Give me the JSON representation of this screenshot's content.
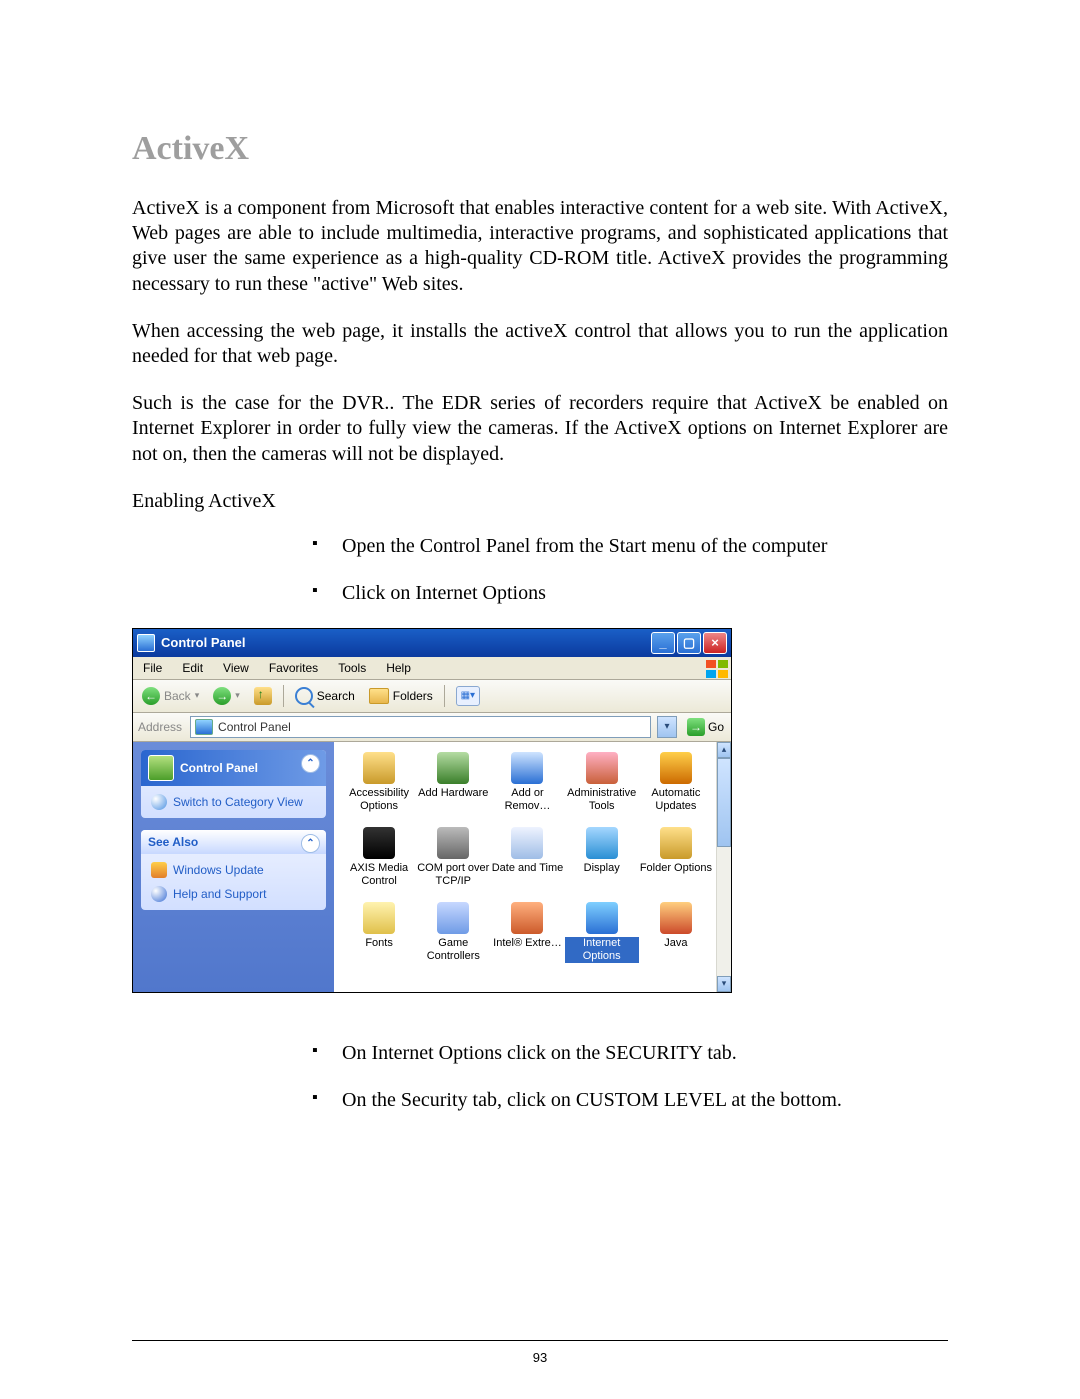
{
  "doc": {
    "title": "ActiveX",
    "p1": "ActiveX is a component from Microsoft that enables interactive content for a web site. With ActiveX, Web pages are able to include multimedia, interactive programs, and sophisticated applications that give  user the same experience as a high-quality CD-ROM title. ActiveX provides the programming necessary to run these \"active\" Web sites.",
    "p2": "When accessing the web page, it installs the activeX control that allows you to run the application needed for that web page.",
    "p3": "Such is the case for the DVR.. The EDR series of recorders require that ActiveX be enabled on Internet Explorer in order to fully view the cameras. If the ActiveX options on Internet Explorer are not on, then the cameras will not be displayed.",
    "enable_heading": "Enabling ActiveX",
    "steps_a": [
      "Open the Control Panel from the Start menu of the computer",
      "Click on Internet Options"
    ],
    "steps_b": [
      "On Internet Options click on the SECURITY tab.",
      "On the Security tab, click on CUSTOM LEVEL at the bottom."
    ],
    "page_number": "93"
  },
  "win": {
    "title": "Control Panel",
    "menubar": [
      "File",
      "Edit",
      "View",
      "Favorites",
      "Tools",
      "Help"
    ],
    "toolbar": {
      "back": "Back",
      "search": "Search",
      "folders": "Folders"
    },
    "address_label": "Address",
    "address_value": "Control Panel",
    "go_label": "Go",
    "side": {
      "cp_panel_title": "Control Panel",
      "switch_view": "Switch to Category View",
      "see_also_title": "See Also",
      "see_also_links": [
        "Windows Update",
        "Help and Support"
      ]
    },
    "icons": [
      {
        "label": "Accessibility Options",
        "glyph": "g-access"
      },
      {
        "label": "Add Hardware",
        "glyph": "g-addhw"
      },
      {
        "label": "Add or Remov…",
        "glyph": "g-addrm"
      },
      {
        "label": "Administrative Tools",
        "glyph": "g-admin"
      },
      {
        "label": "Automatic Updates",
        "glyph": "g-upd"
      },
      {
        "label": "AXIS Media Control",
        "glyph": "g-axis"
      },
      {
        "label": "COM port over TCP/IP",
        "glyph": "g-com"
      },
      {
        "label": "Date and Time",
        "glyph": "g-date"
      },
      {
        "label": "Display",
        "glyph": "g-disp"
      },
      {
        "label": "Folder Options",
        "glyph": "g-fold"
      },
      {
        "label": "Fonts",
        "glyph": "g-fonts"
      },
      {
        "label": "Game Controllers",
        "glyph": "g-game"
      },
      {
        "label": "Intel® Extre…",
        "glyph": "g-intel"
      },
      {
        "label": "Internet Options",
        "glyph": "g-inet",
        "selected": true
      },
      {
        "label": "Java",
        "glyph": "g-java"
      }
    ]
  }
}
